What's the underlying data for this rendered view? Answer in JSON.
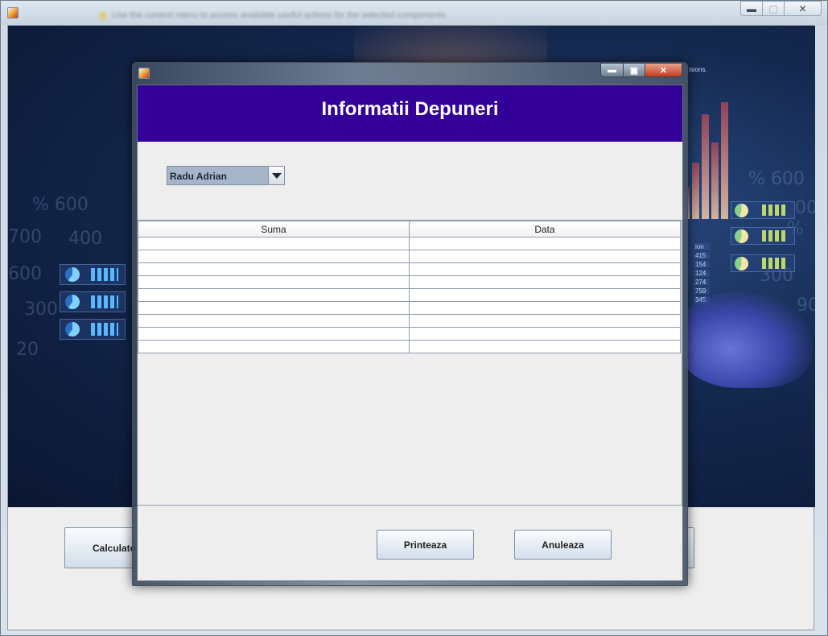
{
  "main_window": {
    "hint_text": "Use the context menu to access available useful actions for the selected components.",
    "buttons": {
      "calculator_label": "Calculato",
      "right_label": ""
    },
    "background": {
      "floating_text": [
        "% 600",
        "400",
        "700",
        "600",
        "300",
        "% 600",
        "20",
        "00",
        "90",
        "%",
        "300",
        "300"
      ],
      "value_list": [
        "ion",
        "415",
        "154",
        "124",
        "274",
        "759",
        "345"
      ],
      "corner_text": "isions."
    }
  },
  "dialog": {
    "title": "Informatii Depuneri",
    "client_select": {
      "value": "Radu Adrian"
    },
    "table": {
      "columns": [
        "Suma",
        "Data"
      ],
      "rows": [
        [
          "",
          ""
        ],
        [
          "",
          ""
        ],
        [
          "",
          ""
        ],
        [
          "",
          ""
        ],
        [
          "",
          ""
        ],
        [
          "",
          ""
        ],
        [
          "",
          ""
        ],
        [
          "",
          ""
        ],
        [
          "",
          ""
        ]
      ]
    },
    "buttons": {
      "print_label": "Printeaza",
      "cancel_label": "Anuleaza"
    }
  },
  "colors": {
    "header": "#330099",
    "select_bg": "#a7b5c9",
    "close_button": "#c33b1e"
  }
}
